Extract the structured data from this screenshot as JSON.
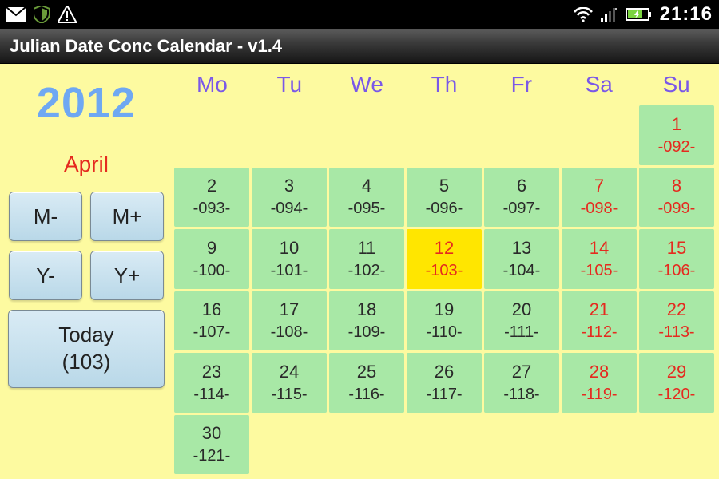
{
  "status_bar": {
    "time": "21:16",
    "icons": [
      "mail",
      "shield",
      "alert",
      "wifi",
      "signal",
      "battery-charging"
    ]
  },
  "window": {
    "title": "Julian Date Conc Calendar - v1.4"
  },
  "sidebar": {
    "year": "2012",
    "month": "April",
    "month_minus": "M-",
    "month_plus": "M+",
    "year_minus": "Y-",
    "year_plus": "Y+",
    "today_top": "Today",
    "today_bottom": "(103)"
  },
  "calendar": {
    "dow": [
      "Mo",
      "Tu",
      "We",
      "Th",
      "Fr",
      "Sa",
      "Su"
    ],
    "today_day": 12,
    "weeks": [
      [
        null,
        null,
        null,
        null,
        null,
        null,
        {
          "d": 1,
          "j": "-092-"
        }
      ],
      [
        {
          "d": 2,
          "j": "-093-"
        },
        {
          "d": 3,
          "j": "-094-"
        },
        {
          "d": 4,
          "j": "-095-"
        },
        {
          "d": 5,
          "j": "-096-"
        },
        {
          "d": 6,
          "j": "-097-"
        },
        {
          "d": 7,
          "j": "-098-"
        },
        {
          "d": 8,
          "j": "-099-"
        }
      ],
      [
        {
          "d": 9,
          "j": "-100-"
        },
        {
          "d": 10,
          "j": "-101-"
        },
        {
          "d": 11,
          "j": "-102-"
        },
        {
          "d": 12,
          "j": "-103-"
        },
        {
          "d": 13,
          "j": "-104-"
        },
        {
          "d": 14,
          "j": "-105-"
        },
        {
          "d": 15,
          "j": "-106-"
        }
      ],
      [
        {
          "d": 16,
          "j": "-107-"
        },
        {
          "d": 17,
          "j": "-108-"
        },
        {
          "d": 18,
          "j": "-109-"
        },
        {
          "d": 19,
          "j": "-110-"
        },
        {
          "d": 20,
          "j": "-111-"
        },
        {
          "d": 21,
          "j": "-112-"
        },
        {
          "d": 22,
          "j": "-113-"
        }
      ],
      [
        {
          "d": 23,
          "j": "-114-"
        },
        {
          "d": 24,
          "j": "-115-"
        },
        {
          "d": 25,
          "j": "-116-"
        },
        {
          "d": 26,
          "j": "-117-"
        },
        {
          "d": 27,
          "j": "-118-"
        },
        {
          "d": 28,
          "j": "-119-"
        },
        {
          "d": 29,
          "j": "-120-"
        }
      ],
      [
        {
          "d": 30,
          "j": "-121-"
        },
        null,
        null,
        null,
        null,
        null,
        null
      ]
    ]
  }
}
